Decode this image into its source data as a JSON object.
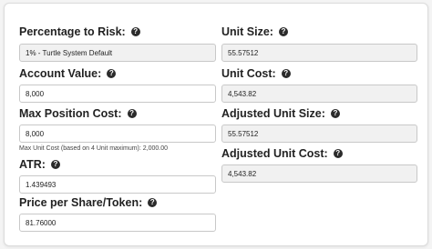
{
  "left": {
    "risk": {
      "label": "Percentage to Risk:",
      "value": "1% - Turtle System Default"
    },
    "account": {
      "label": "Account Value:",
      "value": "8,000"
    },
    "max_position": {
      "label": "Max Position Cost:",
      "value": "8,000",
      "hint": "Max Unit Cost (based on 4 Unit maximum): 2,000.00"
    },
    "atr": {
      "label": "ATR:",
      "value": "1.439493"
    },
    "price": {
      "label": "Price per Share/Token:",
      "value": "81.76000"
    }
  },
  "right": {
    "unit_size": {
      "label": "Unit Size:",
      "value": "55.57512"
    },
    "unit_cost": {
      "label": "Unit Cost:",
      "value": "4,543.82"
    },
    "adj_unit_size": {
      "label": "Adjusted Unit Size:",
      "value": "55.57512"
    },
    "adj_unit_cost": {
      "label": "Adjusted Unit Cost:",
      "value": "4,543.82"
    }
  },
  "help_glyph": "?",
  "icons": {
    "help": "question-circle-icon"
  }
}
